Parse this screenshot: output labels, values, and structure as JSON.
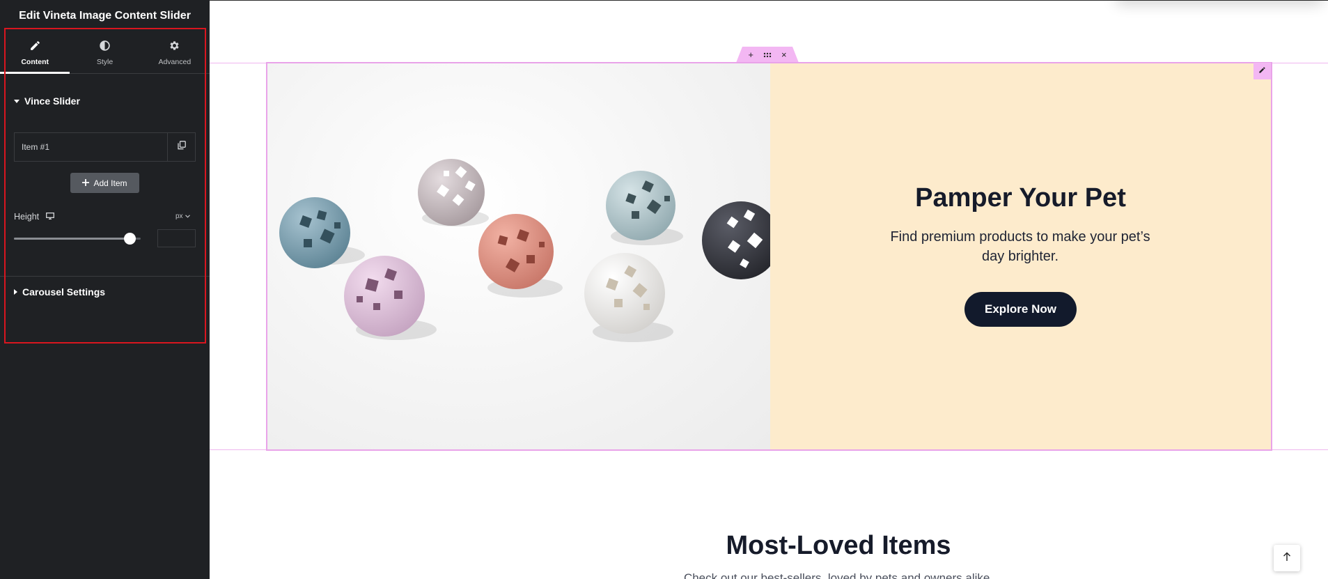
{
  "sidebar": {
    "title": "Edit Vineta Image Content Slider",
    "tabs": [
      {
        "label": "Content",
        "icon": "pencil-icon",
        "active": true
      },
      {
        "label": "Style",
        "icon": "contrast-icon",
        "active": false
      },
      {
        "label": "Advanced",
        "icon": "gear-icon",
        "active": false
      }
    ],
    "section_slider": {
      "label": "Vince Slider",
      "expanded": true
    },
    "repeater_items": [
      {
        "label": "Item #1"
      }
    ],
    "add_item_label": "Add Item",
    "height_control": {
      "label": "Height",
      "unit": "px",
      "slider_fraction": 0.91,
      "value": ""
    },
    "section_carousel": {
      "label": "Carousel Settings",
      "expanded": false
    },
    "highlight_color": "#d9161f"
  },
  "slide": {
    "title": "Pamper Your Pet",
    "description": "Find premium products to make your pet’s day brighter.",
    "button_label": "Explore Now",
    "panel_color": "#fdebcc",
    "button_color": "#121a2c"
  },
  "section": {
    "title": "Most-Loved Items",
    "subtitle": "Check out our best-sellers, loved by pets and owners alike."
  },
  "editor_colors": {
    "outline": "#e9a3e9",
    "handle": "#f3b7f3"
  }
}
